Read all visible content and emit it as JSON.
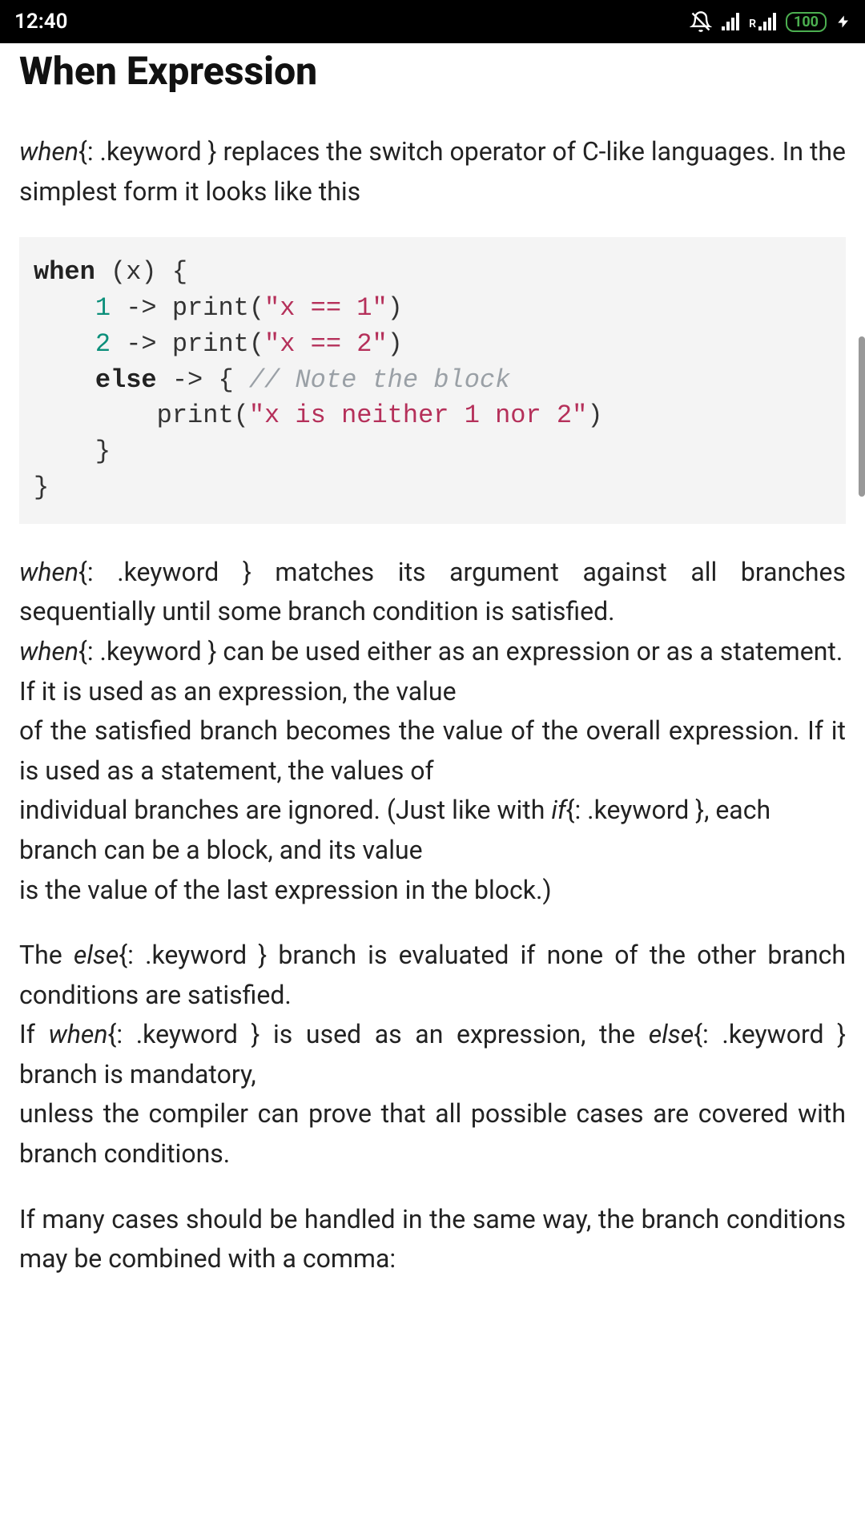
{
  "status": {
    "time": "12:40",
    "battery": "100",
    "network_label": "R"
  },
  "title": "When Expression",
  "intro": {
    "kw1": "when",
    "kw1_suffix": "{: .keyword }",
    "rest": " replaces the switch operator of C-like languages. In the simplest form it looks like this"
  },
  "code": {
    "l1a": "when",
    "l1b": " (x) {",
    "l2a": "    ",
    "l2num": "1",
    "l2b": " -> print(",
    "l2str": "\"x == 1\"",
    "l2c": ")",
    "l3a": "    ",
    "l3num": "2",
    "l3b": " -> print(",
    "l3str": "\"x == 2\"",
    "l3c": ")",
    "l4a": "    ",
    "l4kw": "else",
    "l4b": " -> { ",
    "l4cmt": "// Note the block",
    "l5a": "        print(",
    "l5str": "\"x is neither 1 nor 2\"",
    "l5b": ")",
    "l6": "    }",
    "l7": "}"
  },
  "p2": {
    "kw1": "when",
    "kw1_suffix": "{: .keyword }",
    "t1": " matches its argument against all branches sequentially until some branch condition is satisfied.",
    "kw2": "when",
    "kw2_suffix": "{: .keyword }",
    "t2": " can be used either as an expression or as a statement. If it is used as an expression, the value",
    "t3": "of the satisfied branch becomes the value of the overall expression. If it is used as a statement, the values of",
    "t4a": "individual branches are ignored. (Just like with ",
    "kw3": "if",
    "kw3_suffix": "{: .keyword }",
    "t4b": ", each branch can be a block, and its value",
    "t5": "is the value of the last expression in the block.)"
  },
  "p3": {
    "t1a": "The ",
    "kw1": "else",
    "kw1_suffix": "{: .keyword }",
    "t1b": " branch is evaluated if none of the other branch conditions are satisfied.",
    "t2a": "If ",
    "kw2": "when",
    "kw2_suffix": "{: .keyword }",
    "t2b": " is used as an expression, the ",
    "kw3": "else",
    "kw3_suffix": "{: .keyword }",
    "t2c": " branch is mandatory,",
    "t3": "unless the compiler can prove that all possible cases are covered with branch conditions."
  },
  "p4": {
    "t1": "If many cases should be handled in the same way, the branch conditions may be combined with a comma:"
  }
}
